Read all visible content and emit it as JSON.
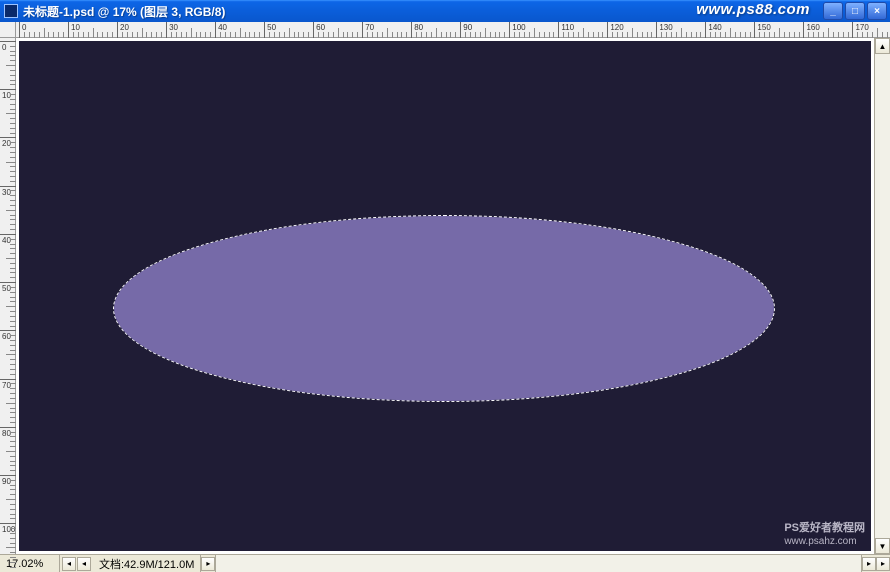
{
  "titlebar": {
    "title": "未标题-1.psd @ 17% (图层 3, RGB/8)",
    "watermark": "www.ps88.com"
  },
  "ruler": {
    "h_ticks": [
      0,
      10,
      20,
      30,
      40,
      50,
      60,
      70,
      80,
      90,
      100,
      110,
      120,
      130,
      140,
      150,
      160,
      170
    ],
    "v_ticks": [
      0,
      10,
      20,
      30,
      40,
      50,
      60,
      70,
      80,
      90,
      100
    ]
  },
  "canvas": {
    "bg_color": "#1f1c35",
    "ellipse_color": "#766aa8",
    "watermark_line1": "PS爱好者教程网",
    "watermark_line2": "www.psahz.com"
  },
  "status": {
    "zoom": "17.02%",
    "doc": "文档:42.9M/121.0M"
  }
}
